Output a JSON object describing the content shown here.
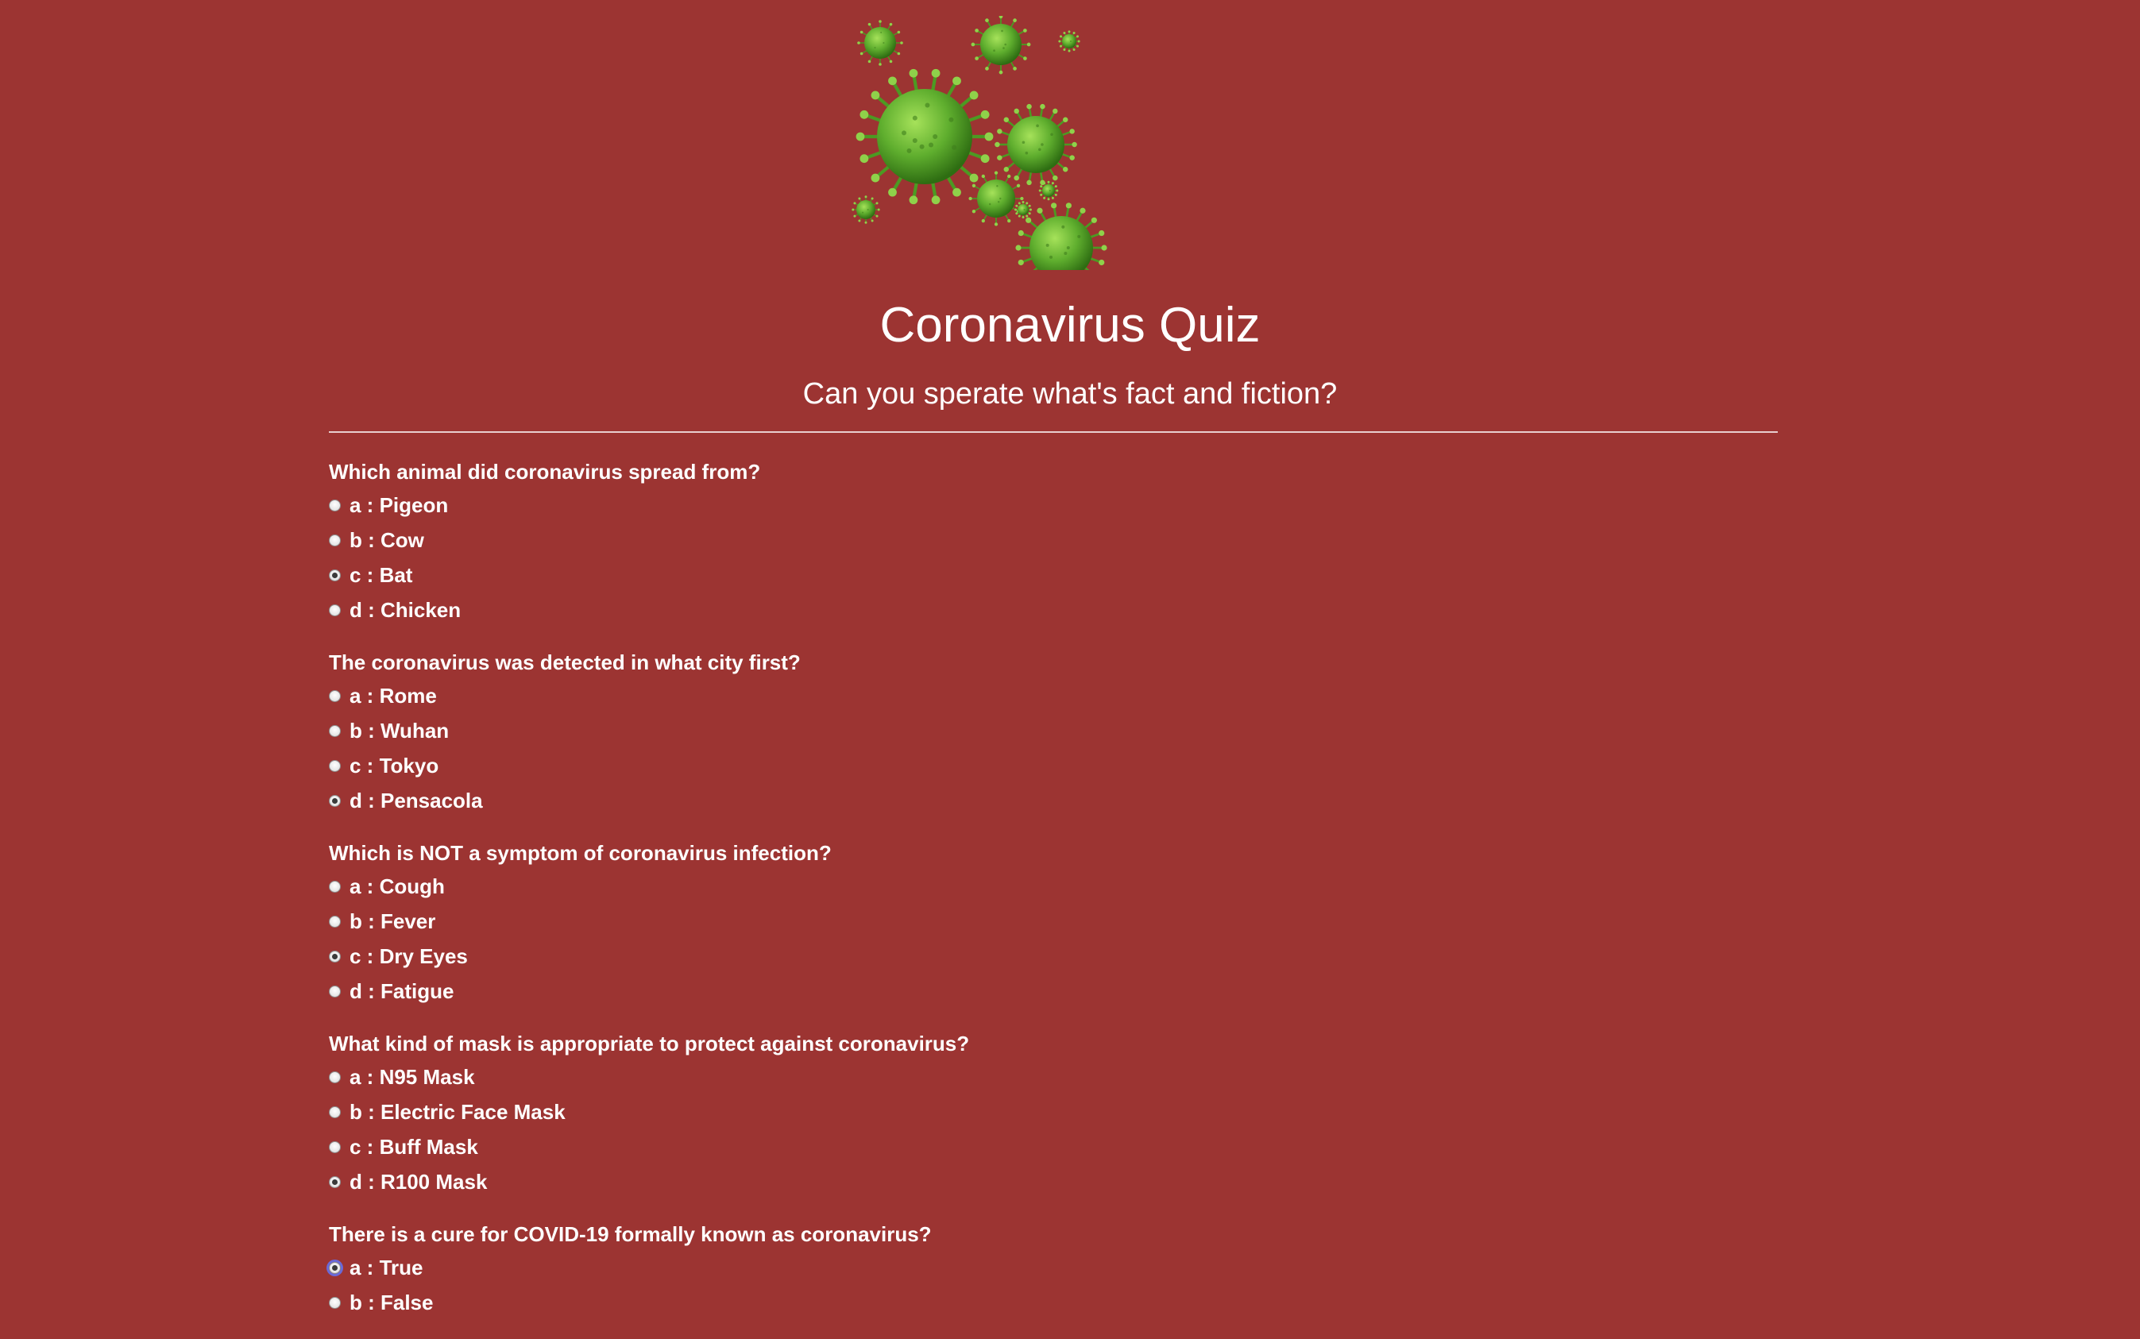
{
  "header": {
    "title": "Coronavirus Quiz",
    "subtitle": "Can you sperate what's fact and fiction?"
  },
  "colors": {
    "background": "#9c3432",
    "text": "#ffffff",
    "virus_green": "#5fae2e"
  },
  "questions": [
    {
      "text": "Which animal did coronavirus spread from?",
      "options": [
        {
          "label": "a : Pigeon",
          "checked": false
        },
        {
          "label": "b : Cow",
          "checked": false
        },
        {
          "label": "c : Bat",
          "checked": true
        },
        {
          "label": "d : Chicken",
          "checked": false
        }
      ]
    },
    {
      "text": "The coronavirus was detected in what city first?",
      "options": [
        {
          "label": "a : Rome",
          "checked": false
        },
        {
          "label": "b : Wuhan",
          "checked": false
        },
        {
          "label": "c : Tokyo",
          "checked": false
        },
        {
          "label": "d : Pensacola",
          "checked": true
        }
      ]
    },
    {
      "text": "Which is NOT a symptom of coronavirus infection?",
      "options": [
        {
          "label": "a : Cough",
          "checked": false
        },
        {
          "label": "b : Fever",
          "checked": false
        },
        {
          "label": "c : Dry Eyes",
          "checked": true
        },
        {
          "label": "d : Fatigue",
          "checked": false
        }
      ]
    },
    {
      "text": "What kind of mask is appropriate to protect against coronavirus?",
      "options": [
        {
          "label": "a : N95 Mask",
          "checked": false
        },
        {
          "label": "b : Electric Face Mask",
          "checked": false
        },
        {
          "label": "c : Buff Mask",
          "checked": false
        },
        {
          "label": "d : R100 Mask",
          "checked": true
        }
      ]
    },
    {
      "text": "There is a cure for COVID-19 formally known as coronavirus?",
      "options": [
        {
          "label": "a : True",
          "checked": true,
          "focused": true
        },
        {
          "label": "b : False",
          "checked": false
        }
      ]
    }
  ]
}
